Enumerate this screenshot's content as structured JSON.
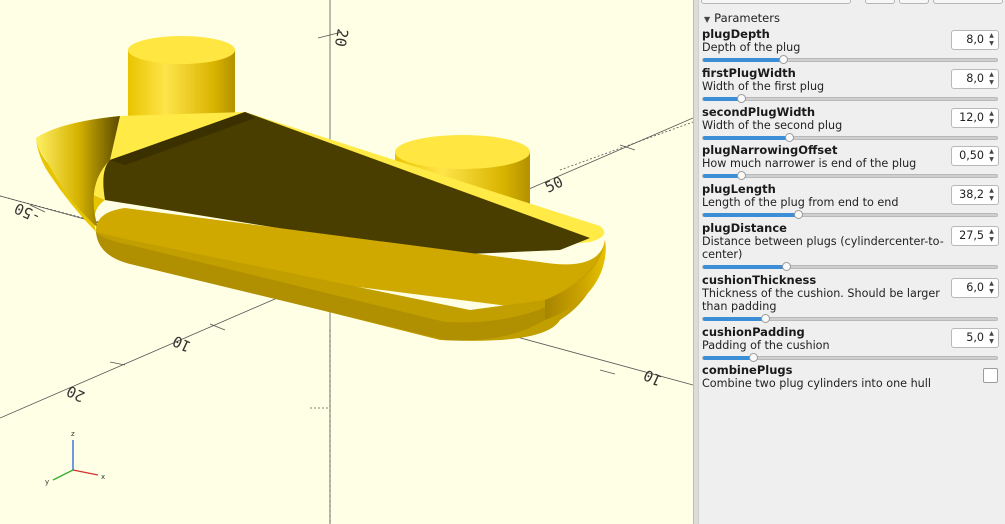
{
  "viewport": {
    "axis_tick_labels": [
      "20",
      "-50",
      "10",
      "50",
      "20",
      "10"
    ],
    "gizmo_labels": {
      "z": "z",
      "x": "x",
      "y": "y"
    },
    "model_color": "#f5d800"
  },
  "panel": {
    "section_title": "Parameters",
    "parameters": [
      {
        "name": "plugDepth",
        "description": "Depth of the plug",
        "value": "8,0",
        "slider": 0.27
      },
      {
        "name": "firstPlugWidth",
        "description": "Width of the first plug",
        "value": "8,0",
        "slider": 0.13
      },
      {
        "name": "secondPlugWidth",
        "description": "Width of the second plug",
        "value": "12,0",
        "slider": 0.29
      },
      {
        "name": "plugNarrowingOffset",
        "description": "How much narrower is end of the plug",
        "value": "0,50",
        "slider": 0.13
      },
      {
        "name": "plugLength",
        "description": "Length of the plug from end to end",
        "value": "38,2",
        "slider": 0.32
      },
      {
        "name": "plugDistance",
        "description": "Distance between plugs (cylindercenter-to-center)",
        "value": "27,5",
        "slider": 0.28
      },
      {
        "name": "cushionThickness",
        "description": "Thickness of the cushion. Should be larger than padding",
        "value": "6,0",
        "slider": 0.21
      },
      {
        "name": "cushionPadding",
        "description": "Padding of the cushion",
        "value": "5,0",
        "slider": 0.17
      }
    ],
    "checkbox_param": {
      "name": "combinePlugs",
      "description": "Combine two plug cylinders into one hull",
      "checked": false
    }
  }
}
